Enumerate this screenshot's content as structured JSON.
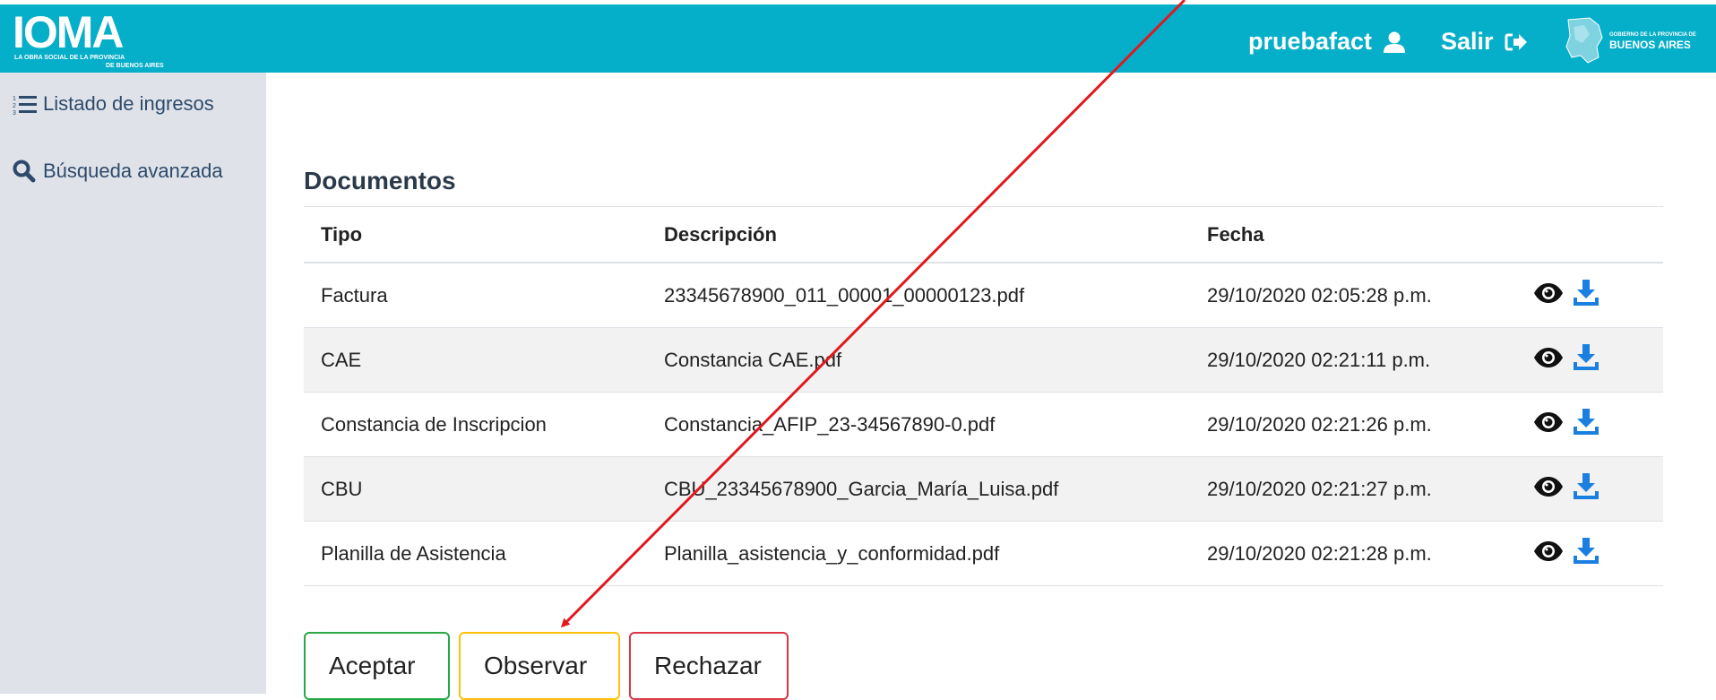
{
  "header": {
    "logo": {
      "name": "IOMA",
      "subtitle_line1": "LA OBRA SOCIAL DE LA PROVINCIA",
      "subtitle_line2": "DE BUENOS AIRES"
    },
    "user": {
      "name": "pruebafact",
      "icon": "user-icon"
    },
    "logout": {
      "label": "Salir",
      "icon": "sign-out-icon"
    },
    "gov_logo": {
      "small": "GOBIERNO DE LA PROVINCIA DE",
      "big": "BUENOS AIRES"
    },
    "bar_color": "#05aec9"
  },
  "sidebar": {
    "items": [
      {
        "label": "Listado de ingresos",
        "icon": "list-ordered-icon"
      },
      {
        "label": "Búsqueda avanzada",
        "icon": "search-icon"
      }
    ]
  },
  "main": {
    "title": "Documentos",
    "table": {
      "columns": [
        "Tipo",
        "Descripción",
        "Fecha",
        ""
      ],
      "rows": [
        {
          "tipo": "Factura",
          "descripcion": "23345678900_011_00001_00000123.pdf",
          "fecha": "29/10/2020 02:05:28 p.m."
        },
        {
          "tipo": "CAE",
          "descripcion": "Constancia CAE.pdf",
          "fecha": "29/10/2020 02:21:11 p.m."
        },
        {
          "tipo": "Constancia de Inscripcion",
          "descripcion": "Constancia_AFIP_23-34567890-0.pdf",
          "fecha": "29/10/2020 02:21:26 p.m."
        },
        {
          "tipo": "CBU",
          "descripcion": "CBU_23345678900_Garcia_María_Luisa.pdf",
          "fecha": "29/10/2020 02:21:27 p.m."
        },
        {
          "tipo": "Planilla de Asistencia",
          "descripcion": "Planilla_asistencia_y_conformidad.pdf",
          "fecha": "29/10/2020 02:21:28 p.m."
        }
      ],
      "row_actions": [
        "eye-icon",
        "download-icon"
      ]
    },
    "buttons": {
      "accept": "Aceptar",
      "observe": "Observar",
      "reject": "Rechazar"
    }
  },
  "colors": {
    "accept": "#28a745",
    "observe": "#ffc107",
    "reject": "#dc3545",
    "download": "#1a7fe0",
    "annotation_arrow": "#e0191e"
  }
}
